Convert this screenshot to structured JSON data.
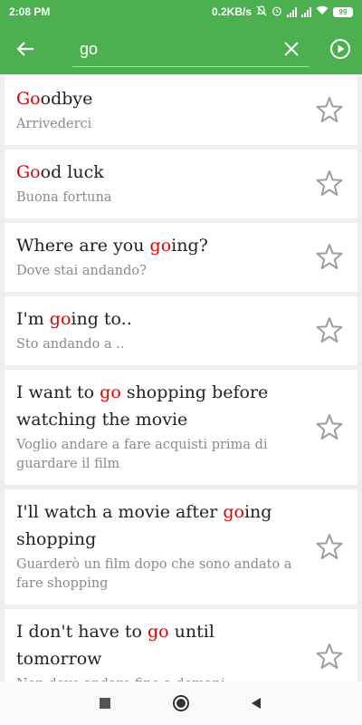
{
  "status": {
    "time": "2:08 PM",
    "network_speed": "0.2KB/s",
    "battery": "99"
  },
  "search": {
    "value": "go",
    "placeholder": ""
  },
  "icons": {
    "back": "arrow-left-icon",
    "clear": "close-icon",
    "play": "play-circle-icon",
    "star": "star-outline-icon"
  },
  "colors": {
    "accent": "#4caf50",
    "highlight": "#e00000"
  },
  "results": [
    {
      "parts": [
        {
          "hl": "Go"
        },
        {
          "t": "odbye"
        }
      ],
      "translation": "Arrivederci"
    },
    {
      "parts": [
        {
          "hl": "Go"
        },
        {
          "t": "od luck"
        }
      ],
      "translation": "Buona fortuna"
    },
    {
      "parts": [
        {
          "t": "Where are you "
        },
        {
          "hl": "go"
        },
        {
          "t": "ing?"
        }
      ],
      "translation": "Dove stai andando?"
    },
    {
      "parts": [
        {
          "t": "I'm "
        },
        {
          "hl": "go"
        },
        {
          "t": "ing to.."
        }
      ],
      "translation": "Sto andando a .."
    },
    {
      "parts": [
        {
          "t": "I want to "
        },
        {
          "hl": "go"
        },
        {
          "t": " shopping before watching the movie"
        }
      ],
      "translation": "Voglio andare a fare acquisti prima di guardare il film"
    },
    {
      "parts": [
        {
          "t": "I'll watch a movie after "
        },
        {
          "hl": "go"
        },
        {
          "t": "ing shopping"
        }
      ],
      "translation": "Guarderò un film dopo che sono andato a fare shopping"
    },
    {
      "parts": [
        {
          "t": "I don't have to "
        },
        {
          "hl": "go"
        },
        {
          "t": " until tomorrow"
        }
      ],
      "translation": "Non devo andare fino a domani"
    }
  ]
}
